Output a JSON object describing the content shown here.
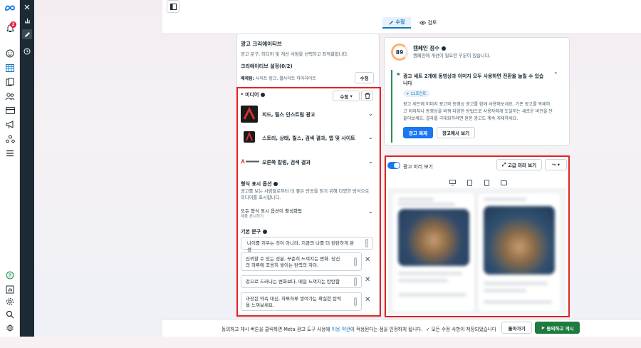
{
  "sidebar": {
    "notification_count": "2"
  },
  "tabs": {
    "edit": "수정",
    "review": "검토"
  },
  "creative": {
    "title": "광고 크리에이티브",
    "subtitle": "광고 문구, 미디어 및 개선 사항을 선택하고 최적화합니다.",
    "settings_title": "크리에이티브 설정(0/2)",
    "exclude_label": "배제됨:",
    "exclude_value": "사이트 링크, 웹사이트 하이라이트",
    "edit_button": "수정"
  },
  "media": {
    "title": "미디어",
    "required_mark": "*",
    "edit_button": "수정",
    "items": [
      {
        "label": "피드, 릴스 인스트림 광고"
      },
      {
        "label": "스토리, 상태, 릴스, 검색 결과, 앱 및 사이트"
      },
      {
        "label": "오른쪽 칼럼, 검색 결과"
      }
    ]
  },
  "format_options": {
    "title": "형식 표시 옵션",
    "desc_line1": "광고를 보는 사람들로부터 더 좋은 반응을 얻기 위해 다양한 방식으로",
    "desc_line2": "미디어를 표시합니다.",
    "status": "모든 형식 표시 옵션이 활성화됨",
    "status_sub": "제품 표시하기"
  },
  "primary_text": {
    "title": "기본 문구",
    "items": [
      {
        "line1": "나이를 지우는 것이 아니라, 지금의 나를 더 탄탄하게 완성",
        "line2": ""
      },
      {
        "line1": "신뢰할 수 있는 성분, 꾸준히 느껴지는 변화. 당신",
        "line2": "의 하루에 조용히 쌓이는 탄력의 차이."
      },
      {
        "line1": "겉으로 드러나는 변화보다, 매일 느껴지는 탄탄함",
        "line2": ""
      },
      {
        "line1": "과장된 약속 대신, 하루하루 쌓여가는 확실한 탄력",
        "line2": "을 느껴보세요."
      }
    ]
  },
  "campaign_score": {
    "score": "89",
    "title": "캠페인 점수",
    "subtitle": "캠페인에 개선이 필요한 부분이 있습니다."
  },
  "recommendation": {
    "title_line1": "광고 세트 2개에 동영상과 이미지 모두 사용하면 전환을 늘릴 수 있습",
    "title_line2": "니다",
    "badge": "+ 11포인트",
    "body_line1": "광고 세트에 이미지 광고와 동영상 광고를 함께 사용해보세요. 기존 광고를 복제하",
    "body_line2": "고 이미지나 동영상을 바꿔 다양한 방법으로 사용자에게 도달하는 새로운 버전을 만",
    "body_line3": "들어보세요. 결과를 극대화하려면 원본 광고도 계속 게재하세요.",
    "primary_button": "광고 복제",
    "secondary_button": "광고에서 보기"
  },
  "preview": {
    "toggle_label": "광고 미리 보기",
    "advanced_button": "고급 미리 보기"
  },
  "footer": {
    "notice_prefix": "동의하고 게시 버튼을 클릭하면 Meta 광고 도구 사용에",
    "notice_link": "이용 약관",
    "notice_suffix": "이 적용된다는 점을 인정하게 됩니다.",
    "saved_status": "모든 수정 사항이 저장되었습니다",
    "back_button": "돌아가기",
    "publish_button": "동의하고 게시"
  },
  "colors": {
    "accent": "#1877f2",
    "publish_green": "#1f7a3f",
    "highlight_red": "#e02424",
    "sidebar_dark": "#1c2b33"
  }
}
